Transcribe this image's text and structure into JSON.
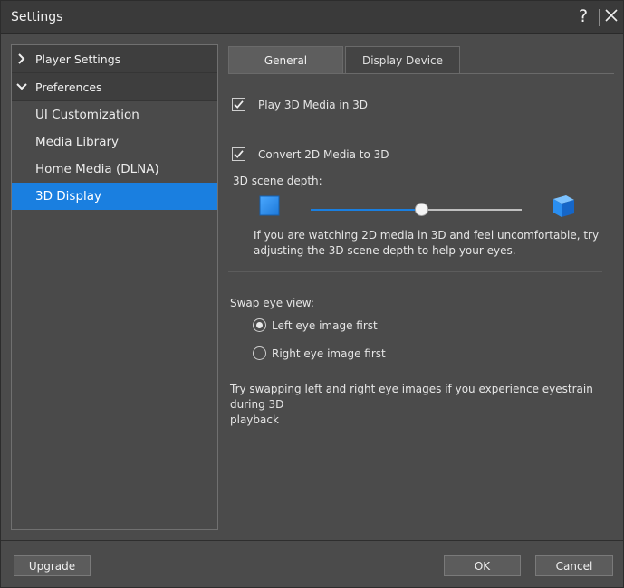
{
  "window": {
    "title": "Settings",
    "help_glyph": "?"
  },
  "sidebar": {
    "groups": [
      {
        "label": "Player Settings",
        "expanded": false
      },
      {
        "label": "Preferences",
        "expanded": true,
        "items": [
          {
            "label": "UI Customization",
            "active": false
          },
          {
            "label": "Media Library",
            "active": false
          },
          {
            "label": "Home Media (DLNA)",
            "active": false
          },
          {
            "label": "3D Display",
            "active": true
          }
        ]
      }
    ]
  },
  "tabs": [
    {
      "label": "General",
      "active": true
    },
    {
      "label": "Display Device",
      "active": false
    }
  ],
  "general": {
    "play3d": {
      "label": "Play 3D Media in 3D",
      "checked": true
    },
    "convert2d": {
      "label": "Convert 2D Media to 3D",
      "checked": true
    },
    "scene_depth": {
      "label": "3D scene depth:",
      "value_fraction": 0.53,
      "help_line1": "If you are watching 2D media in 3D and feel uncomfortable, try",
      "help_line2": "adjusting the 3D scene depth to help your eyes."
    },
    "swap_eye": {
      "label": "Swap eye view:",
      "options": [
        {
          "label": "Left eye image first",
          "selected": true
        },
        {
          "label": "Right eye image first",
          "selected": false
        }
      ],
      "help_line1": "Try swapping left and right eye images if you experience eyestrain during 3D",
      "help_line2": "playback"
    }
  },
  "footer": {
    "upgrade_label": "Upgrade",
    "ok_label": "OK",
    "cancel_label": "Cancel"
  },
  "colors": {
    "accent": "#1a7fe0",
    "background": "#4b4b4b",
    "titlebar": "#3a3a3a"
  }
}
